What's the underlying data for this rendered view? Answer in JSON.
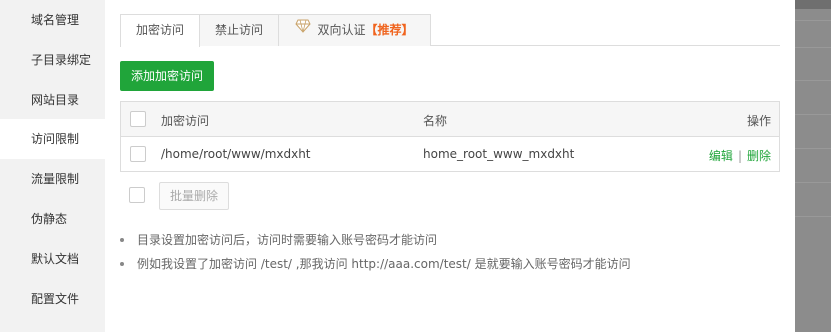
{
  "sidebar": {
    "items": [
      {
        "label": "域名管理"
      },
      {
        "label": "子目录绑定"
      },
      {
        "label": "网站目录"
      },
      {
        "label": "访问限制"
      },
      {
        "label": "流量限制"
      },
      {
        "label": "伪静态"
      },
      {
        "label": "默认文档"
      },
      {
        "label": "配置文件"
      }
    ],
    "active_index": 3
  },
  "tabs": {
    "encrypt": "加密访问",
    "forbid": "禁止访问",
    "twoway": "双向认证",
    "recommend": "【推荐】",
    "active": "加密访问"
  },
  "add_button": "添加加密访问",
  "table": {
    "headers": {
      "path": "加密访问",
      "name": "名称",
      "ops": "操作"
    },
    "rows": [
      {
        "path": "/home/root/www/mxdxht",
        "name": "home_root_www_mxdxht",
        "edit": "编辑",
        "sep": "|",
        "delete": "删除"
      }
    ]
  },
  "batch_delete": "批量删除",
  "notes": [
    "目录设置加密访问后，访问时需要输入账号密码才能访问",
    "例如我设置了加密访问 /test/ ,那我访问 http://aaa.com/test/ 是就要输入账号密码才能访问"
  ],
  "colors": {
    "accent": "#20a53a",
    "recommend": "#f0641e",
    "sidebar_bg": "#f2f2f2"
  },
  "icons": {
    "twoway_tab": "diamond-icon"
  }
}
